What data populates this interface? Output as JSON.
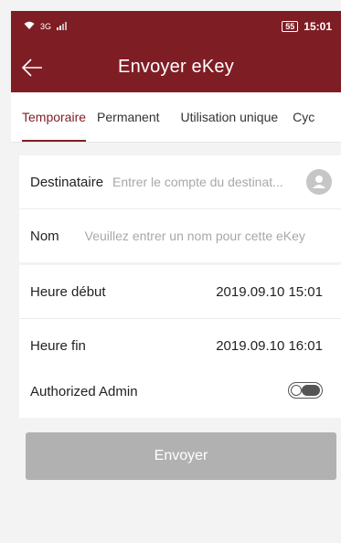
{
  "status_bar": {
    "network": "3G",
    "battery": "55",
    "time": "15:01"
  },
  "header": {
    "title": "Envoyer eKey",
    "back_icon": "arrow-left-icon",
    "color": "#7f1d24"
  },
  "tabs": [
    {
      "label": "Temporaire",
      "active": true
    },
    {
      "label": "Permanent",
      "active": false
    },
    {
      "label": "Utilisation unique",
      "active": false
    },
    {
      "label": "Cyc",
      "active": false
    }
  ],
  "form": {
    "recipient": {
      "label": "Destinataire",
      "placeholder": "Entrer le compte du destinat...",
      "icon": "contact-icon"
    },
    "name": {
      "label": "Nom",
      "placeholder": "Veuillez entrer un nom pour cette eKey"
    },
    "start": {
      "label": "Heure début",
      "value": "2019.09.10 15:01"
    },
    "end": {
      "label": "Heure fin",
      "value": "2019.09.10 16:01"
    },
    "admin": {
      "label": "Authorized Admin",
      "enabled": false
    }
  },
  "send_button": {
    "label": "Envoyer"
  }
}
